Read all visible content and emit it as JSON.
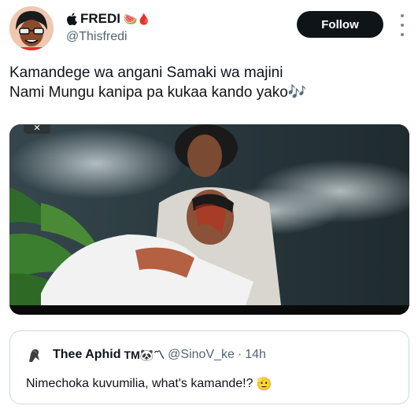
{
  "author": {
    "display_name": "FREDI",
    "name_emojis": "🍉🩸",
    "handle": "@Thisfredi"
  },
  "actions": {
    "follow_label": "Follow"
  },
  "tweet": {
    "line1": "Kamandege wa angani Samaki wa majini",
    "line2": "Nami Mungu kanipa pa kukaa kando yako",
    "line2_emoji": "🎶"
  },
  "quote": {
    "display_name": "Thee Aphid",
    "name_suffix": "TM🐼〽",
    "handle": "@SinoV_ke",
    "separator": "·",
    "time": "14h",
    "text": "Nimechoka kuvumilia, what's kamande!?",
    "text_emoji": "🫡"
  },
  "icons": {
    "apple": "apple-logo-icon",
    "more": "more-options-icon"
  },
  "colors": {
    "follow_bg": "#0f1419",
    "handle": "#536471",
    "border": "#cfd9de"
  }
}
